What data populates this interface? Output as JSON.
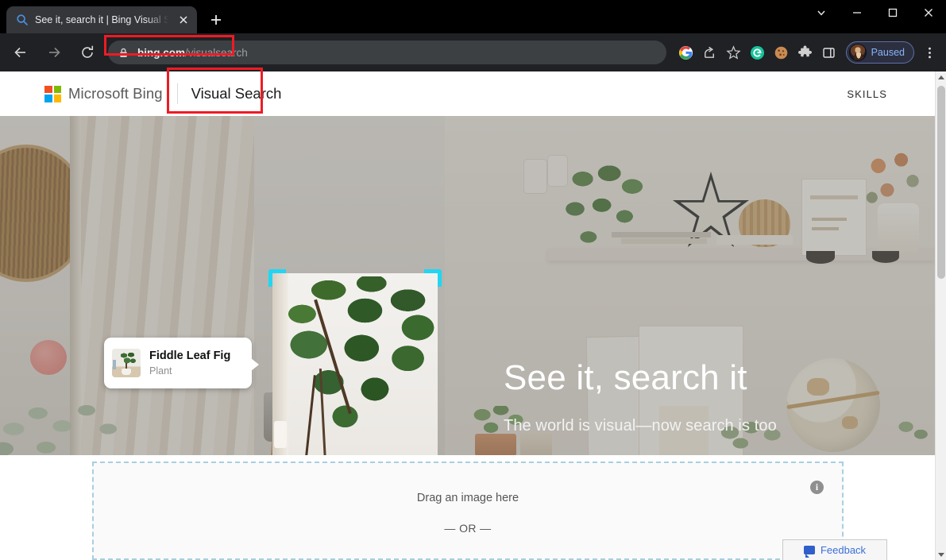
{
  "browser": {
    "tab": {
      "title": "See it, search it | Bing Visual Sear",
      "favicon": "search-icon",
      "close": "×"
    },
    "newtab_label": "+",
    "window_controls": {
      "tab_search": "tab-search-chevron-down-icon",
      "minimize": "minimize-icon",
      "maximize": "maximize-icon",
      "close": "close-icon"
    },
    "nav": {
      "back": "back-arrow-icon",
      "forward": "forward-arrow-icon",
      "reload": "reload-icon"
    },
    "omnibox": {
      "lock": "lock-icon",
      "host": "bing.com",
      "path": "/visualsearch"
    },
    "toolbar_icons": [
      "google-icon",
      "share-icon",
      "bookmark-star-icon",
      "grammarly-icon",
      "cookie-icon",
      "extensions-puzzle-icon",
      "side-panel-icon"
    ],
    "profile": {
      "status_label": "Paused",
      "avatar": "user-avatar"
    },
    "menu": "three-dot-menu-icon"
  },
  "site": {
    "brand": {
      "name": "Microsoft Bing",
      "logo_colors": [
        "#f25022",
        "#7fba00",
        "#00a4ef",
        "#ffb900"
      ]
    },
    "product_label": "Visual Search",
    "nav_link": "SKILLS"
  },
  "hero": {
    "heading": "See it, search it",
    "subheading": "The world is visual—now search is too",
    "selection": {
      "corner_color": "#20d6f2",
      "result_card": {
        "title": "Fiddle Leaf Fig",
        "subtitle": "Plant",
        "thumbnail": "fiddle-leaf-fig-thumbnail"
      }
    }
  },
  "dropzone": {
    "drag_text": "Drag an image here",
    "or_text": "— OR —",
    "info_icon": "i"
  },
  "feedback": {
    "label": "Feedback",
    "icon": "feedback-bubble-icon",
    "accent": "#3a6fd8"
  },
  "annotations": {
    "url_highlight_color": "#ee1b24",
    "product_label_highlight_color": "#ee1b24"
  }
}
